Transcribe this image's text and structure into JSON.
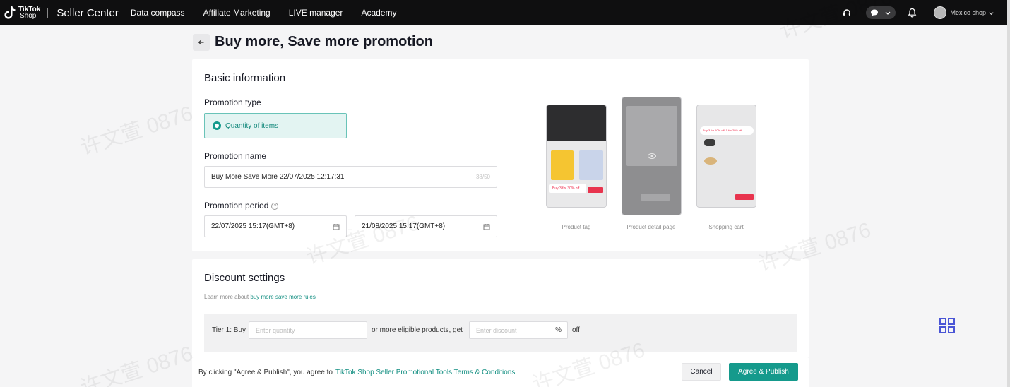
{
  "topbar": {
    "logo_line1": "TikTok",
    "logo_line2": "Shop",
    "brand": "Seller Center",
    "nav": [
      "Data compass",
      "Affiliate Marketing",
      "LIVE manager",
      "Academy"
    ],
    "shop_name": "Mexico shop"
  },
  "page": {
    "title": "Buy more, Save more promotion"
  },
  "basic": {
    "section_title": "Basic information",
    "type_label": "Promotion type",
    "type_value": "Quantity of items",
    "name_label": "Promotion name",
    "name_value": "Buy More Save More 22/07/2025 12:17:31",
    "name_counter": "38/50",
    "period_label": "Promotion period",
    "period_start": "22/07/2025 15:17(GMT+8)",
    "period_sep": "–",
    "period_end": "21/08/2025 15:17(GMT+8)"
  },
  "previews": [
    {
      "caption": "Product tag",
      "badge": "Buy 3 for 30% off"
    },
    {
      "caption": "Product detail page",
      "badge": ""
    },
    {
      "caption": "Shopping cart",
      "badge": "Buy 3 for 10% off, 5 for 20% off"
    }
  ],
  "discount": {
    "section_title": "Discount settings",
    "learn_prefix": "Learn more about ",
    "learn_link": "buy more save more rules",
    "tier_label": "Tier 1: Buy",
    "qty_placeholder": "Enter quantity",
    "mid_text": "or more eligible products, get",
    "discount_placeholder": "Enter discount",
    "pct": "%",
    "off_text": "off"
  },
  "footer": {
    "text": "By clicking \"Agree & Publish\", you agree to",
    "link": "TikTok Shop Seller Promotional Tools Terms & Conditions",
    "cancel": "Cancel",
    "publish": "Agree & Publish"
  },
  "watermark": "许文萱 0876",
  "colors": {
    "accent": "#159a8c",
    "topbar": "#0f0f10",
    "selected_bg": "#e3f4f2"
  }
}
